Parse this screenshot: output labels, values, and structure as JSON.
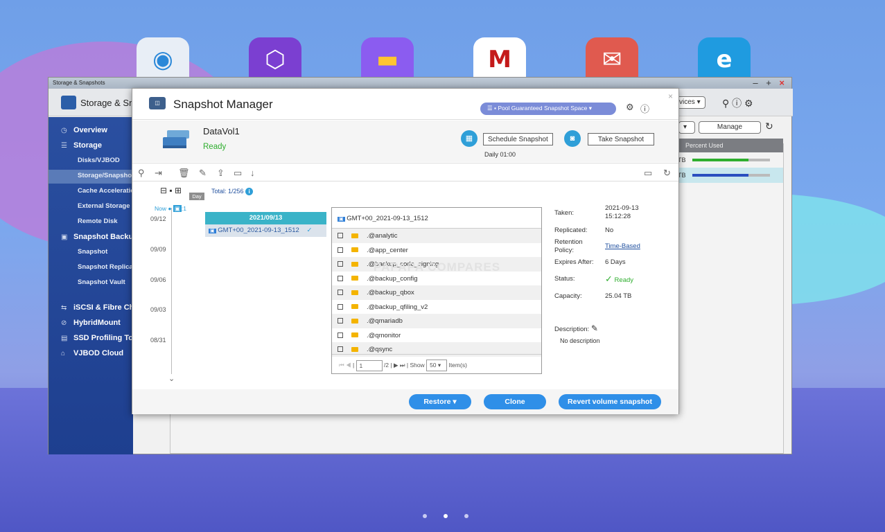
{
  "desktop": {
    "dock_icons": [
      "qfinder-icon",
      "qboost-icon",
      "file-station-icon",
      "mcafee-icon",
      "qmail-icon",
      "hybrid-backup-icon"
    ],
    "dock_colors": [
      "#e8eef6",
      "#7b3fd1",
      "#8b5cf0",
      "#ffffff",
      "#e05a4f",
      "#1f9be0"
    ]
  },
  "window": {
    "title": "Storage & Snapshots",
    "app_name": "Storage & Sna",
    "services_btn": "vices",
    "manage_btn": "Manage",
    "percent_used": "Percent Used",
    "rows": [
      {
        "unit": "TB",
        "used": 0.72,
        "color": "#2fae2f"
      },
      {
        "unit": "TB",
        "used": 0.72,
        "color": "#2b4fbf"
      }
    ]
  },
  "sidebar": {
    "items": [
      {
        "label": "Overview",
        "icon": "dashboard-icon",
        "sub": false
      },
      {
        "label": "Storage",
        "icon": "database-icon",
        "sub": false
      },
      {
        "label": "Disks/VJBOD",
        "sub": true
      },
      {
        "label": "Storage/Snapshots",
        "sub": true,
        "active": true
      },
      {
        "label": "Cache Acceleration",
        "sub": true
      },
      {
        "label": "External Storage",
        "sub": true
      },
      {
        "label": "Remote Disk",
        "sub": true
      },
      {
        "label": "Snapshot Backup",
        "icon": "snapshot-icon",
        "sub": false
      },
      {
        "label": "Snapshot",
        "sub": true
      },
      {
        "label": "Snapshot Replica",
        "sub": true
      },
      {
        "label": "Snapshot Vault",
        "sub": true
      },
      {
        "label": "iSCSI & Fibre Channel",
        "icon": "iscsi-icon",
        "sub": false
      },
      {
        "label": "HybridMount",
        "icon": "hybridmount-icon",
        "sub": false
      },
      {
        "label": "SSD Profiling Tool",
        "icon": "ssd-icon",
        "sub": false
      },
      {
        "label": "VJBOD Cloud",
        "icon": "cloud-icon",
        "sub": false
      }
    ]
  },
  "dialog": {
    "title": "Snapshot Manager",
    "pool_label": "Pool Guaranteed Snapshot Space",
    "volume_name": "DataVol1",
    "volume_status": "Ready",
    "schedule_btn": "Schedule Snapshot",
    "take_btn": "Take Snapshot",
    "schedule_time": "Daily 01:00",
    "day_tag": "Day",
    "total": "Total: 1/256",
    "now_label": "Now",
    "now_count": ":1",
    "timeline_dates": [
      "09/12",
      "09/09",
      "09/06",
      "09/03",
      "08/31"
    ],
    "group_date": "2021/09/13",
    "snapshot_name": "GMT+00_2021-09-13_1512",
    "files_header": "GMT+00_2021-09-13_1512",
    "files": [
      ".@analytic",
      ".@app_center",
      ".@backup_code_signing",
      ".@backup_config",
      ".@backup_qbox",
      ".@backup_qfiling_v2",
      ".@qmariadb",
      ".@qmonitor",
      ".@qsync"
    ],
    "pager": {
      "page": "1",
      "of": "/2",
      "show": "Show",
      "per_page": "50",
      "items": "Item(s)"
    },
    "watermark": "PAPAPA COMPARES",
    "details": {
      "taken_label": "Taken:",
      "taken_date": "2021-09-13",
      "taken_time": "15:12:28",
      "replicated_label": "Replicated:",
      "replicated": "No",
      "retention_label1": "Retention",
      "retention_label2": "Policy:",
      "retention": "Time-Based",
      "expires_label": "Expires After:",
      "expires": "6 Days",
      "status_label": "Status:",
      "status": "Ready",
      "capacity_label": "Capacity:",
      "capacity": "25.04 TB",
      "description_label": "Description:",
      "description": "No description"
    },
    "buttons": {
      "restore": "Restore",
      "clone": "Clone",
      "revert": "Revert volume snapshot"
    }
  }
}
